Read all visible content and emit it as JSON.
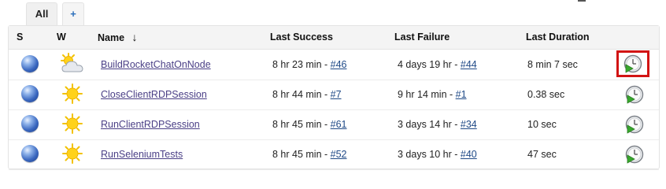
{
  "tabs": {
    "all_label": "All",
    "add_label": "+"
  },
  "columns": {
    "s": "S",
    "w": "W",
    "name": "Name",
    "sort_indicator": "↓",
    "last_success": "Last Success",
    "last_failure": "Last Failure",
    "last_duration": "Last Duration"
  },
  "rows": [
    {
      "status_icon": "blue-ball-icon",
      "weather_icon": "partly-cloudy-icon",
      "name": "BuildRocketChatOnNode",
      "last_success_time": "8 hr 23 min - ",
      "last_success_build": "#46",
      "last_failure_time": "4 days 19 hr - ",
      "last_failure_build": "#44",
      "duration": "8 min 7 sec",
      "action_icon": "schedule-build-icon",
      "highlighted": true
    },
    {
      "status_icon": "blue-ball-icon",
      "weather_icon": "sunny-icon",
      "name": "CloseClientRDPSession",
      "last_success_time": "8 hr 44 min - ",
      "last_success_build": "#7",
      "last_failure_time": "9 hr 14 min - ",
      "last_failure_build": "#1",
      "duration": "0.38 sec",
      "action_icon": "schedule-build-icon",
      "highlighted": false
    },
    {
      "status_icon": "blue-ball-icon",
      "weather_icon": "sunny-icon",
      "name": "RunClientRDPSession",
      "last_success_time": "8 hr 45 min - ",
      "last_success_build": "#61",
      "last_failure_time": "3 days 14 hr - ",
      "last_failure_build": "#34",
      "duration": "10 sec",
      "action_icon": "schedule-build-icon",
      "highlighted": false
    },
    {
      "status_icon": "blue-ball-icon",
      "weather_icon": "sunny-icon",
      "name": "RunSeleniumTests",
      "last_success_time": "8 hr 45 min - ",
      "last_success_build": "#52",
      "last_failure_time": "3 days 10 hr - ",
      "last_failure_build": "#40",
      "duration": "47 sec",
      "action_icon": "schedule-build-icon",
      "highlighted": false
    }
  ],
  "colors": {
    "highlight_border": "#d21414",
    "job_link": "#4a3f86",
    "build_link": "#204a87",
    "status_blue": "#3a67bf"
  }
}
